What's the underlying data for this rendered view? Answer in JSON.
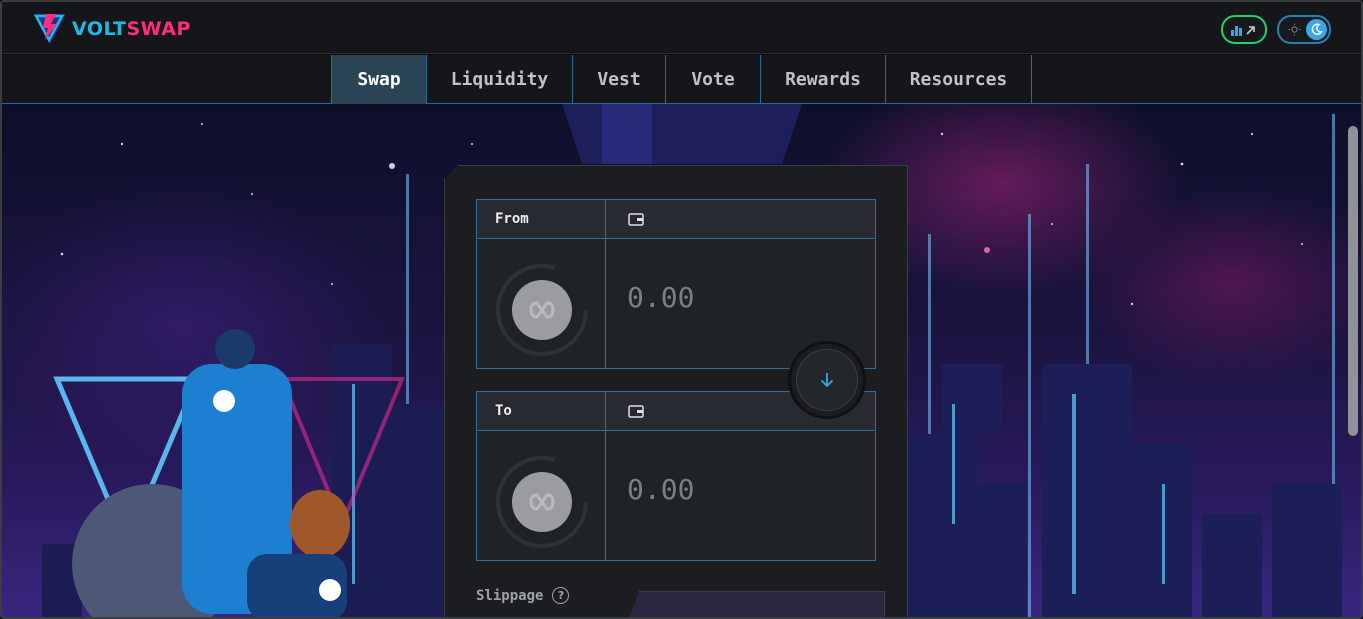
{
  "header": {
    "logo": {
      "part1": "VOLT",
      "part2": "SWAP",
      "icon": "voltswap-logo-icon"
    },
    "stats_button": {
      "icon": "bar-chart-icon"
    },
    "theme_toggle": {
      "icons": [
        "sun-icon",
        "moon-icon"
      ],
      "mode": "dark"
    }
  },
  "nav": {
    "tabs": [
      {
        "label": "Swap",
        "active": true
      },
      {
        "label": "Liquidity",
        "active": false
      },
      {
        "label": "Vest",
        "active": false
      },
      {
        "label": "Vote",
        "active": false
      },
      {
        "label": "Rewards",
        "active": false
      },
      {
        "label": "Resources",
        "active": false
      }
    ]
  },
  "swap": {
    "from": {
      "label": "From",
      "amount": "0.00",
      "token_icon": "token-placeholder-icon",
      "wallet_icon": "wallet-icon"
    },
    "to": {
      "label": "To",
      "amount": "0.00",
      "token_icon": "token-placeholder-icon",
      "wallet_icon": "wallet-icon"
    },
    "direction_icon": "arrow-down-icon",
    "slippage_label": "Slippage",
    "slippage_help": "?"
  },
  "colors": {
    "accent_blue": "#22b8e6",
    "accent_pink": "#ff2d7e",
    "stats_green": "#1fd36b",
    "panel_border": "#2f6f93"
  }
}
